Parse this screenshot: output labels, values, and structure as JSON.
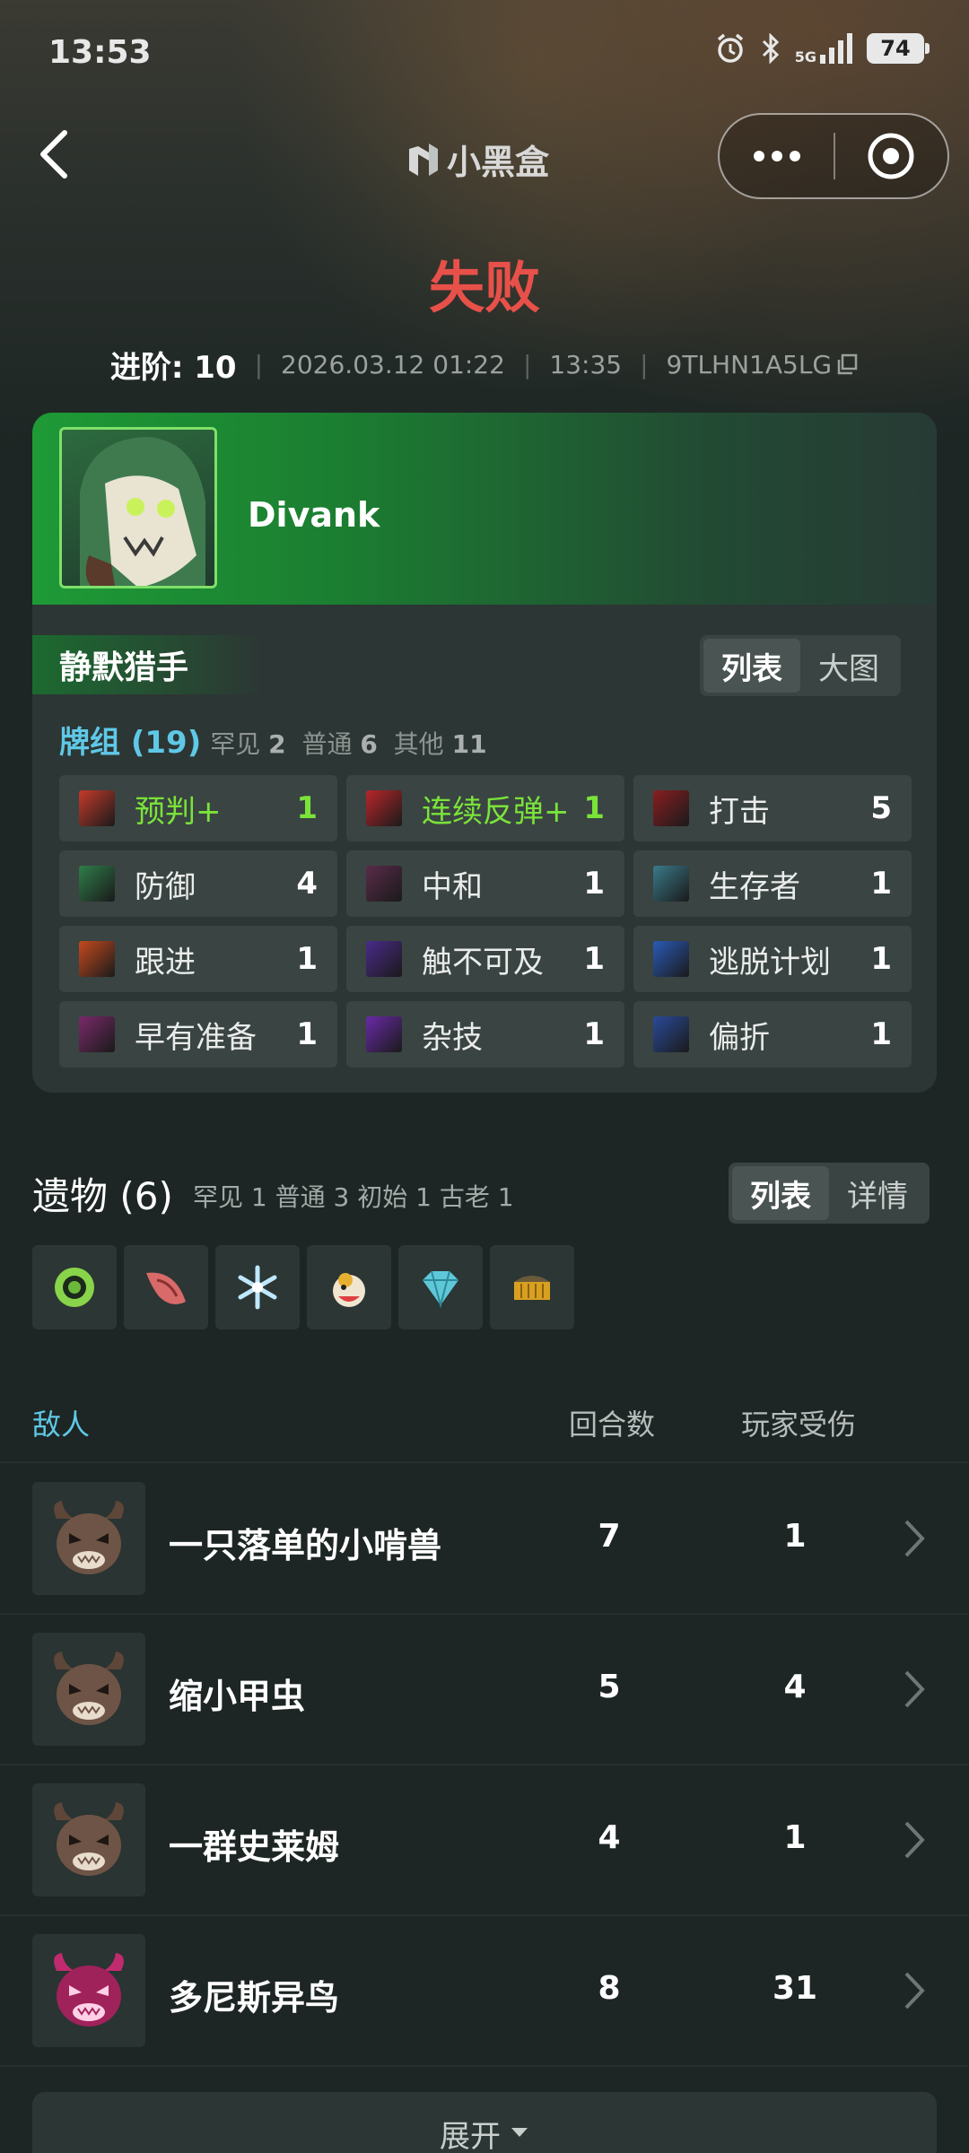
{
  "status_bar": {
    "time": "13:53",
    "network": "5G",
    "battery": "74"
  },
  "nav": {
    "brand": "小黑盒"
  },
  "run": {
    "result": "失败",
    "level": "进阶: 10",
    "date": "2026.03.12 01:22",
    "duration": "13:35",
    "seed": "9TLHN1A5LG"
  },
  "character": {
    "player_name": "Divank",
    "class_name": "静默猎手",
    "view_toggle": [
      "列表",
      "大图"
    ]
  },
  "deck": {
    "title": "牌组 (19)",
    "rare_label": "罕见",
    "rare_count": "2",
    "common_label": "普通",
    "common_count": "6",
    "other_label": "其他",
    "other_count": "11",
    "cards": [
      {
        "name": "预判+",
        "count": "1",
        "upgraded": true,
        "color": "#c43a2a"
      },
      {
        "name": "连续反弹+",
        "count": "1",
        "upgraded": true,
        "color": "#b8262a"
      },
      {
        "name": "打击",
        "count": "5",
        "upgraded": false,
        "color": "#8a1e22"
      },
      {
        "name": "防御",
        "count": "4",
        "upgraded": false,
        "color": "#2f7d4a"
      },
      {
        "name": "中和",
        "count": "1",
        "upgraded": false,
        "color": "#5a2c4a"
      },
      {
        "name": "生存者",
        "count": "1",
        "upgraded": false,
        "color": "#3a7a8a"
      },
      {
        "name": "跟进",
        "count": "1",
        "upgraded": false,
        "color": "#c44a1e"
      },
      {
        "name": "触不可及",
        "count": "1",
        "upgraded": false,
        "color": "#4a2a8a"
      },
      {
        "name": "逃脱计划",
        "count": "1",
        "upgraded": false,
        "color": "#2a5ab8"
      },
      {
        "name": "早有准备",
        "count": "1",
        "upgraded": false,
        "color": "#7a2a6a"
      },
      {
        "name": "杂技",
        "count": "1",
        "upgraded": false,
        "color": "#6a2aa8"
      },
      {
        "name": "偏折",
        "count": "1",
        "upgraded": false,
        "color": "#2a4a9a"
      }
    ]
  },
  "relics": {
    "title": "遗物 (6)",
    "counts": "罕见 1  普通 3  初始 1  古老 1",
    "view_toggle": [
      "列表",
      "详情"
    ],
    "icons": [
      "ring-icon",
      "horn-icon",
      "snowflake-icon",
      "duck-icon",
      "gem-icon",
      "belt-icon"
    ]
  },
  "enemies": {
    "header_label": "敌人",
    "col_turns": "回合数",
    "col_damage": "玩家受伤",
    "rows": [
      {
        "name": "一只落单的小啃兽",
        "turns": "7",
        "damage": "1",
        "type": "normal"
      },
      {
        "name": "缩小甲虫",
        "turns": "5",
        "damage": "4",
        "type": "normal"
      },
      {
        "name": "一群史莱姆",
        "turns": "4",
        "damage": "1",
        "type": "normal"
      },
      {
        "name": "多尼斯异鸟",
        "turns": "8",
        "damage": "31",
        "type": "elite"
      }
    ],
    "expand_label": "展开"
  }
}
